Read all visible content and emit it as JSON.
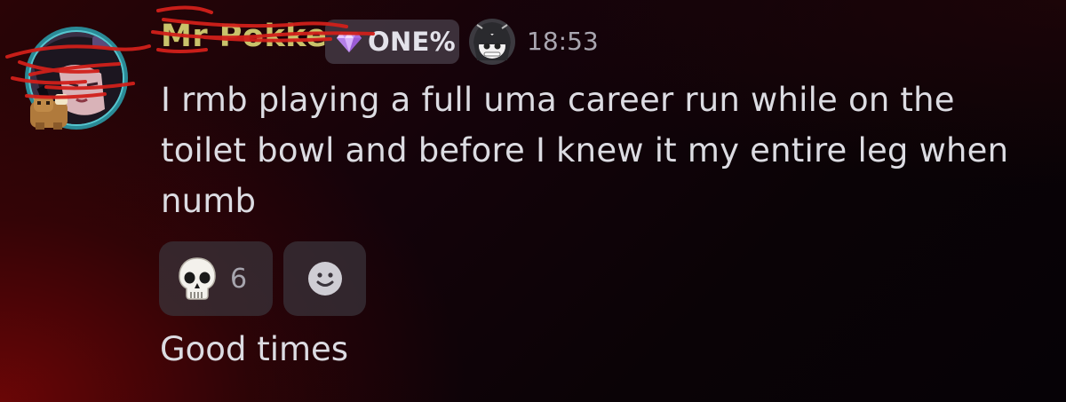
{
  "message": {
    "author": "Mr Pokke",
    "badge": {
      "icon": "diamond-icon",
      "label": "ONE%"
    },
    "timestamp": "18:53",
    "body": "I rmb playing a full uma career run while on the toilet bowl and before I knew it my entire leg when numb",
    "reactions": [
      {
        "emoji": "skull-emoji",
        "count": "6"
      }
    ],
    "add_reaction_icon": "smiley-face-icon"
  },
  "followup": {
    "body": "Good times"
  },
  "colors": {
    "username": "#c9c36b",
    "text": "#dcdce2",
    "timestamp": "#a9a6b0",
    "badge_bg": "#463e48",
    "reaction_bg": "#3a343c",
    "scribble": "#d1201a"
  }
}
